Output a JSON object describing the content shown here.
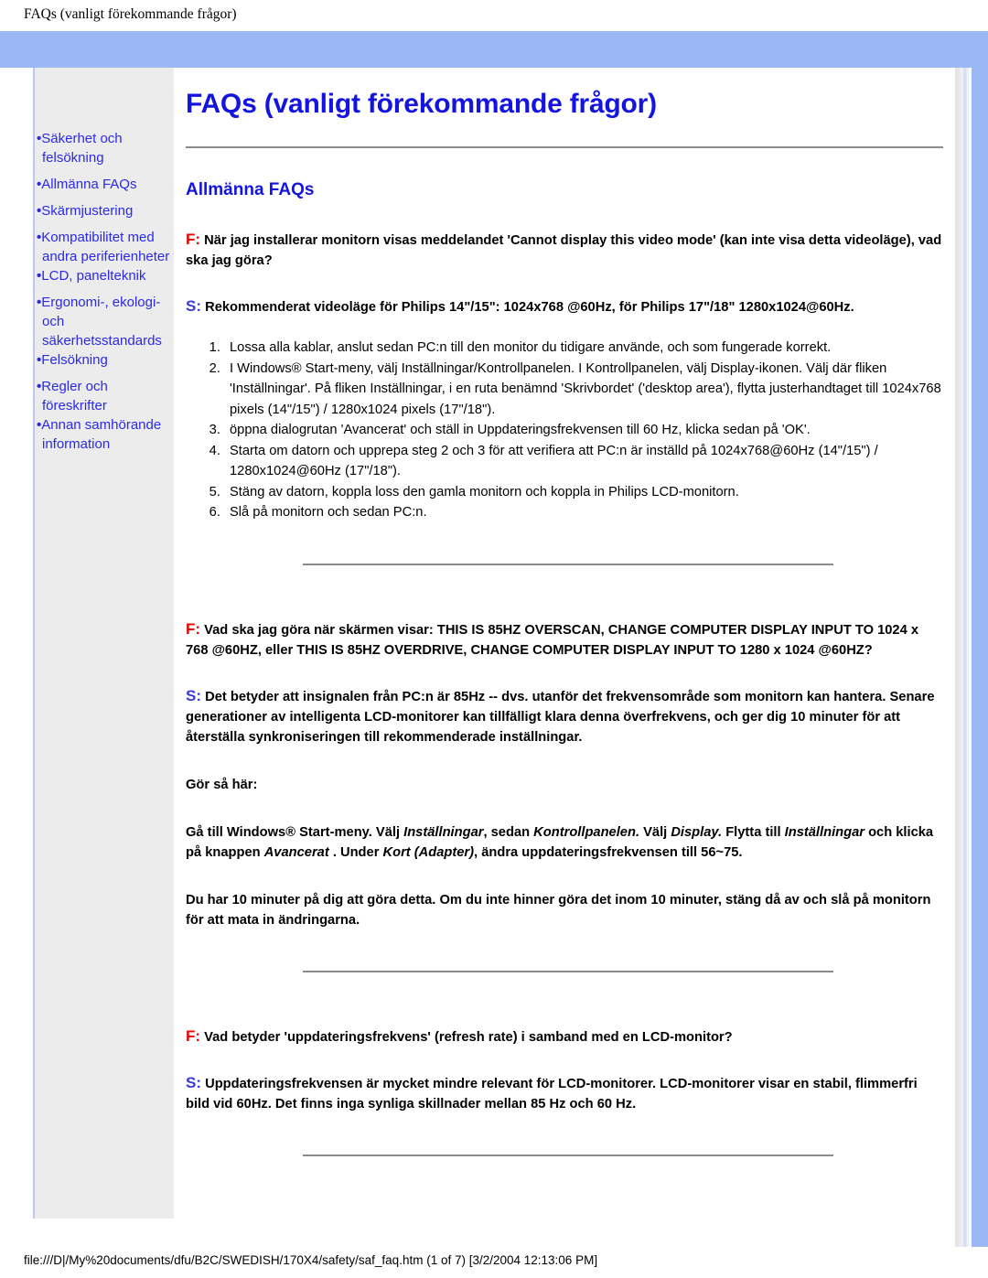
{
  "browser": {
    "print_header": "FAQs (vanligt förekommande frågor)",
    "status_footer": "file:///D|/My%20documents/dfu/B2C/SWEDISH/170X4/safety/saf_faq.htm (1 of 7) [3/2/2004 12:13:06 PM]"
  },
  "colors": {
    "frame_blue": "#9bb8f5",
    "sidebar_bg": "#ececec",
    "link_blue": "#2a2ae8",
    "title_blue": "#1414e0",
    "question_red": "#ee0000",
    "answer_blue": "#3a3ad6"
  },
  "sidebar": {
    "items": [
      {
        "label": "Säkerhet och felsökning"
      },
      {
        "label": "Allmänna FAQs"
      },
      {
        "label": "Skärmjustering"
      },
      {
        "label": "Kompatibilitet med andra periferienheter"
      },
      {
        "label": "LCD, panelteknik"
      },
      {
        "label": "Ergonomi-, ekologi- och säkerhetsstandards"
      },
      {
        "label": "Felsökning"
      },
      {
        "label": "Regler och föreskrifter"
      },
      {
        "label": "Annan samhörande information"
      }
    ]
  },
  "main": {
    "page_title": "FAQs (vanligt förekommande frågor)",
    "section_title": "Allmänna FAQs",
    "markers": {
      "question": "F:",
      "answer": "S:"
    },
    "qa": [
      {
        "question": "När jag installerar monitorn visas meddelandet 'Cannot display this video mode' (kan inte visa detta videoläge), vad ska jag göra?",
        "answer": "Rekommenderat videoläge för Philips 14\"/15\": 1024x768 @60Hz, för Philips 17\"/18\" 1280x1024@60Hz.",
        "steps": [
          "Lossa alla kablar, anslut sedan PC:n till den monitor du tidigare använde, och som fungerade korrekt.",
          "I Windows® Start-meny, välj Inställningar/Kontrollpanelen. I Kontrollpanelen, välj Display-ikonen. Välj där fliken 'Inställningar'. På fliken Inställningar, i en ruta benämnd 'Skrivbordet' ('desktop area'), flytta justerhandtaget till 1024x768 pixels (14\"/15\") / 1280x1024 pixels (17\"/18\").",
          "öppna dialogrutan 'Avancerat' och ställ in Uppdateringsfrekvensen till 60 Hz, klicka sedan på 'OK'.",
          "Starta om datorn och upprepa steg 2 och 3 för att verifiera att PC:n är inställd på 1024x768@60Hz (14\"/15\") / 1280x1024@60Hz (17\"/18\").",
          "Stäng av datorn, koppla loss den gamla monitorn och koppla in Philips LCD-monitorn.",
          "Slå på monitorn och sedan PC:n."
        ]
      },
      {
        "question": "Vad ska jag göra när skärmen visar: THIS IS 85HZ OVERSCAN, CHANGE COMPUTER DISPLAY INPUT TO 1024 x 768 @60HZ, eller THIS IS 85HZ OVERDRIVE, CHANGE COMPUTER DISPLAY INPUT TO 1280 x 1024 @60HZ?",
        "answer": "Det betyder att insignalen från PC:n är 85Hz -- dvs. utanför det frekvensområde som monitorn kan hantera. Senare generationer av intelligenta LCD-monitorer kan tillfälligt klara denna överfrekvens, och ger dig 10 minuter för att återställa synkroniseringen till rekommenderade inställningar.",
        "howto_label": "Gör så här:",
        "howto_text_1a": "Gå till Windows® Start-meny. Välj ",
        "howto_it_1": "Inställningar",
        "howto_text_1b": ", sedan ",
        "howto_it_2": "Kontrollpanelen.",
        "howto_text_1c": " Välj ",
        "howto_it_3": "Display.",
        "howto_text_1d": " Flytta till ",
        "howto_it_4": "Inställningar",
        "howto_text_1e": " och klicka på knappen ",
        "howto_it_5": "Avancerat",
        "howto_text_1f": " . Under ",
        "howto_it_6": "Kort (Adapter)",
        "howto_text_1g": ", ändra uppdateringsfrekvensen till 56~75.",
        "note": "Du har 10 minuter på dig att göra detta. Om du inte hinner göra det inom 10 minuter, stäng då av och slå på monitorn för att mata in ändringarna."
      },
      {
        "question": "Vad betyder 'uppdateringsfrekvens' (refresh rate) i samband med en LCD-monitor?",
        "answer": "Uppdateringsfrekvensen är mycket mindre relevant för LCD-monitorer. LCD-monitorer visar en stabil, flimmerfri bild vid 60Hz. Det finns inga synliga skillnader mellan 85 Hz och 60 Hz."
      }
    ]
  }
}
